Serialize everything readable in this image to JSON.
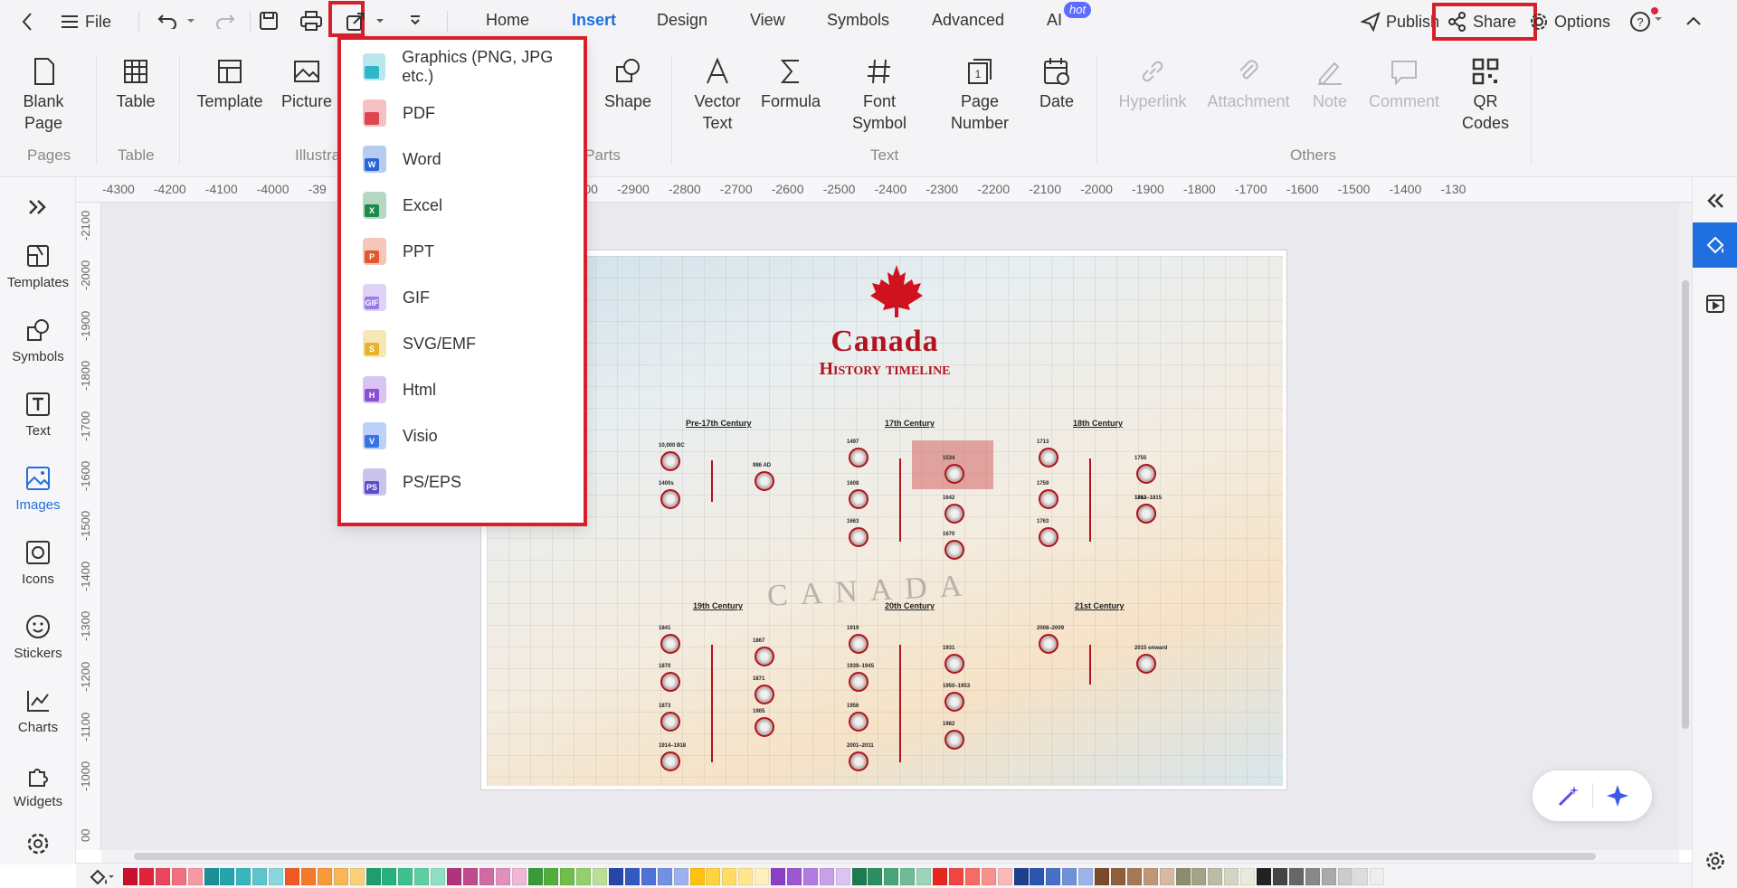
{
  "topbar": {
    "file_label": "File",
    "menu_tabs": [
      "Home",
      "Insert",
      "Design",
      "View",
      "Symbols",
      "Advanced",
      "AI"
    ],
    "active_tab": "Insert",
    "hot_badge": "hot",
    "publish_label": "Publish",
    "share_label": "Share",
    "options_label": "Options"
  },
  "ribbon": {
    "blank_page": "Blank Page",
    "table": "Table",
    "template": "Template",
    "picture": "Picture",
    "shape": "Shape",
    "vector_text": "Vector Text",
    "formula": "Formula",
    "font_symbol": "Font Symbol",
    "page_number": "Page Number",
    "date": "Date",
    "hyperlink": "Hyperlink",
    "attachment": "Attachment",
    "note": "Note",
    "comment": "Comment",
    "qr_codes": "QR Codes",
    "groups": {
      "pages": "Pages",
      "table": "Table",
      "illustrations": "Illustra",
      "parts": "n Parts",
      "text": "Text",
      "others": "Others"
    }
  },
  "left_panel": {
    "items": [
      {
        "label": "Templates",
        "icon": "templates-icon"
      },
      {
        "label": "Symbols",
        "icon": "symbols-icon"
      },
      {
        "label": "Text",
        "icon": "text-icon"
      },
      {
        "label": "Images",
        "icon": "images-icon"
      },
      {
        "label": "Icons",
        "icon": "icons-icon"
      },
      {
        "label": "Stickers",
        "icon": "stickers-icon"
      },
      {
        "label": "Charts",
        "icon": "charts-icon"
      },
      {
        "label": "Widgets",
        "icon": "widgets-icon"
      }
    ],
    "active": "Images"
  },
  "rulers": {
    "horizontal": [
      "-4300",
      "-4200",
      "-4100",
      "-4000",
      "-39",
      "300",
      "-3300",
      "-3200",
      "-3100",
      "-3000",
      "-2900",
      "-2800",
      "-2700",
      "-2600",
      "-2500",
      "-2400",
      "-2300",
      "-2200",
      "-2100",
      "-2000",
      "-1900",
      "-1800",
      "-1700",
      "-1600",
      "-1500",
      "-1400",
      "-130"
    ],
    "vertical": [
      "-2100",
      "-2000",
      "-1900",
      "-1800",
      "-1700",
      "-1600",
      "-1500",
      "-1400",
      "-1300",
      "-1200",
      "-1100",
      "-1000",
      "00"
    ]
  },
  "export_menu": {
    "items": [
      {
        "label": "Graphics (PNG, JPG etc.)",
        "badge": "",
        "color": "#2fb7c9"
      },
      {
        "label": "PDF",
        "badge": "",
        "color": "#e0454b"
      },
      {
        "label": "Word",
        "badge": "W",
        "color": "#2b66d9"
      },
      {
        "label": "Excel",
        "badge": "X",
        "color": "#1e8a4c"
      },
      {
        "label": "PPT",
        "badge": "P",
        "color": "#e2572c"
      },
      {
        "label": "GIF",
        "badge": "GIF",
        "color": "#9b7be8"
      },
      {
        "label": "SVG/EMF",
        "badge": "S",
        "color": "#e8b32a"
      },
      {
        "label": "Html",
        "badge": "H",
        "color": "#8a4fd6"
      },
      {
        "label": "Visio",
        "badge": "V",
        "color": "#3a73e6"
      },
      {
        "label": "PS/EPS",
        "badge": "PS",
        "color": "#5a4fc6"
      }
    ]
  },
  "poster": {
    "title": "Canada",
    "subtitle": "History timeline",
    "watermark": "CANADA",
    "centuries": [
      "Pre-17th Century",
      "17th Century",
      "18th Century",
      "19th Century",
      "20th Century",
      "21st Century"
    ],
    "years": [
      "10,000 BC",
      "1400s",
      "986 AD",
      "1497",
      "1534",
      "1608",
      "1642",
      "1663",
      "1670",
      "1713",
      "1755",
      "1759",
      "1763",
      "1763",
      "1812–1815",
      "1841",
      "1867",
      "1870",
      "1871",
      "1873",
      "1905",
      "1914–1918",
      "1919",
      "1931",
      "1939–1945",
      "1950–1953",
      "1956",
      "1982",
      "2001–2011",
      "2008–2009",
      "2015 onward"
    ]
  },
  "colors": {
    "accent": "#1f6fe0",
    "highlight": "#d9202a",
    "poster_red": "#b3121f",
    "palette": [
      "#c8102e",
      "#e0243a",
      "#e8475d",
      "#f0707f",
      "#f59aa5",
      "#1c8f96",
      "#22a5ad",
      "#37b6bd",
      "#5cc6cc",
      "#8ad6da",
      "#f05a22",
      "#f47a2a",
      "#f79a3a",
      "#f9b556",
      "#fbd07a",
      "#1e9e6e",
      "#28b07e",
      "#3dbf8e",
      "#5fcfa3",
      "#8fdfc0",
      "#b0347a",
      "#c04a8c",
      "#d06aa2",
      "#e090bd",
      "#f0b8d6",
      "#3a9a3a",
      "#52ad3f",
      "#6fbe4b",
      "#93cf6a",
      "#b8df94",
      "#2747a8",
      "#3358c4",
      "#4e72d6",
      "#7191e2",
      "#9bb2ee",
      "#ffc20e",
      "#ffd23f",
      "#ffdd66",
      "#ffe68f",
      "#fff0bb",
      "#8a3fc4",
      "#9d57d2",
      "#b27be0",
      "#c89fea",
      "#dcc3f3",
      "#1f7a4d",
      "#2c8f5f",
      "#47a577",
      "#6ebc95",
      "#9dd3b8",
      "#e8261f",
      "#f0463f",
      "#f56b65",
      "#f8918c",
      "#fbbab7",
      "#1d3f8c",
      "#2a55b0",
      "#4671c7",
      "#6e92d9",
      "#9db4e8",
      "#7a4a2a",
      "#8f5e3a",
      "#a67953",
      "#bf9677",
      "#d8b8a0",
      "#8c8c6e",
      "#a3a387",
      "#bcbca3",
      "#d4d4c2",
      "#eaeadc",
      "#222222",
      "#444444",
      "#666666",
      "#888888",
      "#aaaaaa",
      "#cccccc",
      "#dddddd",
      "#eeeeee"
    ]
  }
}
